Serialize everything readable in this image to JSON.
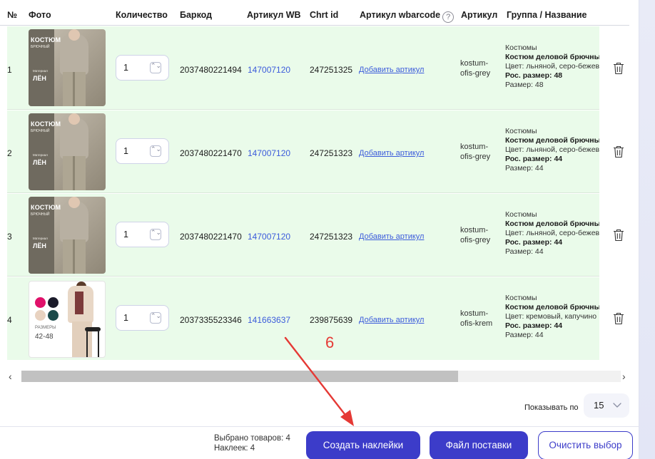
{
  "colors": {
    "accent": "#3c3cc9",
    "link": "#3b5bdb",
    "row_bg": "#eafbea",
    "annotation": "#e53935"
  },
  "columns": {
    "num": "№",
    "photo": "Фото",
    "qty": "Количество",
    "barcode": "Баркод",
    "wb_article": "Артикул WB",
    "chrt": "Chrt id",
    "wbarcode": "Артикул wbarcode",
    "article": "Артикул",
    "group": "Группа / Название"
  },
  "help_glyph": "?",
  "stepper_glyph": "⌃⌄",
  "rows": [
    {
      "idx": "1",
      "image": "suit-photo",
      "img_title": "КОСТЮМ",
      "img_subtitle": "БРЮЧНЫЙ",
      "img_fabric_sub": "Материал",
      "img_fabric": "ЛЁН",
      "qty": "1",
      "barcode": "2037480221494",
      "wb": "147007120",
      "chrt": "247251325",
      "add_link": "Добавить артикул",
      "article_l1": "kostum-",
      "article_l2": "ofis-grey",
      "group": "Костюмы",
      "name": "Костюм деловой брючный",
      "color": "Цвет: льняной, серо-бежевый",
      "ros_size": "Рос. размер: 48",
      "size": "Размер: 48"
    },
    {
      "idx": "2",
      "image": "suit-photo",
      "img_title": "КОСТЮМ",
      "img_subtitle": "БРЮЧНЫЙ",
      "img_fabric_sub": "Материал",
      "img_fabric": "ЛЁН",
      "qty": "1",
      "barcode": "2037480221470",
      "wb": "147007120",
      "chrt": "247251323",
      "add_link": "Добавить артикул",
      "article_l1": "kostum-",
      "article_l2": "ofis-grey",
      "group": "Костюмы",
      "name": "Костюм деловой брючный",
      "color": "Цвет: льняной, серо-бежевый",
      "ros_size": "Рос. размер: 44",
      "size": "Размер: 44"
    },
    {
      "idx": "3",
      "image": "suit-photo",
      "img_title": "КОСТЮМ",
      "img_subtitle": "БРЮЧНЫЙ",
      "img_fabric_sub": "Материал",
      "img_fabric": "ЛЁН",
      "qty": "1",
      "barcode": "2037480221470",
      "wb": "147007120",
      "chrt": "247251323",
      "add_link": "Добавить артикул",
      "article_l1": "kostum-",
      "article_l2": "ofis-grey",
      "group": "Костюмы",
      "name": "Костюм деловой брючный",
      "color": "Цвет: льняной, серо-бежевый",
      "ros_size": "Рос. размер: 44",
      "size": "Размер: 44"
    },
    {
      "idx": "4",
      "image": "beige-suit-photo",
      "img_sizes_label": "РАЗМЕРЫ",
      "img_sizes": "42-48",
      "qty": "1",
      "barcode": "2037335523346",
      "wb": "141663637",
      "chrt": "239875639",
      "add_link": "Добавить артикул",
      "article_l1": "kostum-",
      "article_l2": "ofis-krem",
      "group": "Костюмы",
      "name": "Костюм деловой брючный",
      "color": "Цвет: кремовый, капучино",
      "ros_size": "Рос. размер: 44",
      "size": "Размер: 44"
    }
  ],
  "pagination": {
    "label": "Показывать по",
    "value": "15"
  },
  "scroll": {
    "left_arrow": "‹",
    "right_arrow": "›"
  },
  "footer": {
    "selected": "Выбрано товаров: 4",
    "stickers": "Наклеек: 4",
    "create_btn": "Создать наклейки",
    "file_btn": "Файл поставки",
    "clear_btn": "Очистить выбор"
  },
  "annotation": {
    "step": "6"
  }
}
